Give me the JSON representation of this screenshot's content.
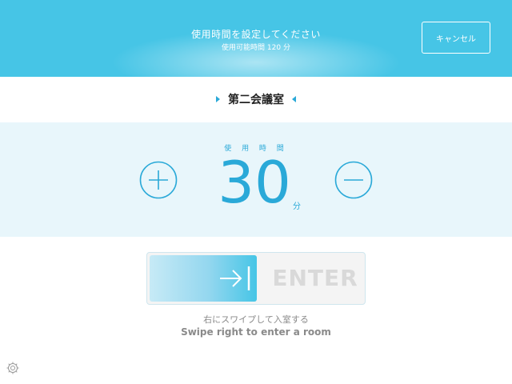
{
  "header": {
    "title": "使用時間を設定してください",
    "subtitle": "使用可能時間 120 分",
    "cancel_label": "キャンセル"
  },
  "room": {
    "name": "第二会議室"
  },
  "duration": {
    "label": "使 用 時 間",
    "value": "30",
    "unit": "分"
  },
  "slider": {
    "enter_label": "ENTER",
    "hint_jp": "右にスワイプして入室する",
    "hint_en": "Swipe right to enter a room"
  },
  "icons": {
    "increase": "plus-circle-icon",
    "decrease": "minus-circle-icon",
    "slider_arrow": "arrow-right-bar-icon",
    "settings": "settings-gear-icon"
  },
  "colors": {
    "accent": "#46c5e6",
    "accent_text": "#2aa9d8",
    "panel_bg": "#e8f6fb"
  }
}
